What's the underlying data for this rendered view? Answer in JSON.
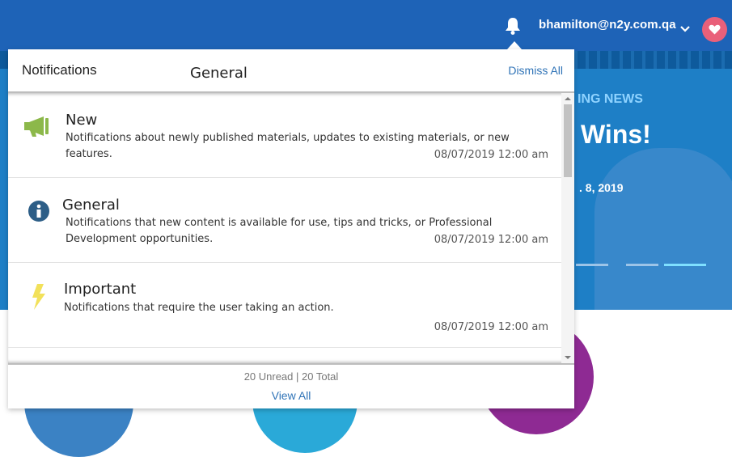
{
  "header": {
    "user_email": "bhamilton@n2y.com.qa",
    "brand_color": "#1e63b7",
    "icons": {
      "bell": "bell-icon",
      "chevron": "chevron-down-icon",
      "favorite": "heart-icon"
    }
  },
  "hero": {
    "kicker": "ING NEWS",
    "title": "Wins!",
    "date": ". 8, 2019",
    "slides": 3,
    "active_slide": 3
  },
  "notifications": {
    "title": "Notifications",
    "category": "General",
    "dismiss_all_label": "Dismiss All",
    "items": [
      {
        "icon": "megaphone-icon",
        "icon_color": "#8cb84a",
        "title": "New",
        "description": "Notifications about newly published materials, updates to existing materials, or new features.",
        "timestamp": "08/07/2019 12:00 am"
      },
      {
        "icon": "info-icon",
        "icon_color": "#2d5e87",
        "title": "General",
        "description": "Notifications that new content is available for use, tips and tricks, or Professional Development opportunities.",
        "timestamp": "08/07/2019 12:00 am"
      },
      {
        "icon": "lightning-icon",
        "icon_color": "#f2e15a",
        "title": "Important",
        "description": "Notifications that require the user taking an action.",
        "timestamp": "08/07/2019 12:00 am"
      }
    ],
    "footer": {
      "counts": "20 Unread | 20 Total",
      "view_all_label": "View All"
    },
    "link_color": "#2f73b7"
  }
}
